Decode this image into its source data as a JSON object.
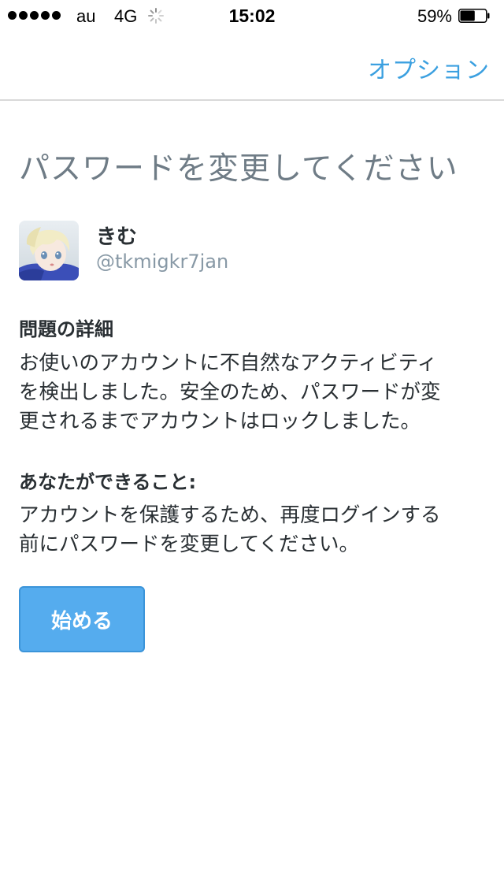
{
  "status_bar": {
    "carrier": "au",
    "network": "4G",
    "time": "15:02",
    "battery_percent": "59%",
    "battery_level": 0.59,
    "signal_bars": 5
  },
  "nav": {
    "options_label": "オプション"
  },
  "main": {
    "title": "パスワードを変更してください",
    "user": {
      "name": "きむ",
      "handle": "@tkmigkr7jan"
    },
    "details": {
      "heading": "問題の詳細",
      "lines": [
        "お使いのアカウントに不自然なアクティビティ",
        "を検出しました。安全のため、パスワードが変",
        "更されるまでアカウントはロックしました。"
      ]
    },
    "actions": {
      "heading": "あなたができること:",
      "lines": [
        "アカウントを保護するため、再度ログインする",
        "前にパスワードを変更してください。"
      ]
    },
    "start_button_label": "始める"
  },
  "colors": {
    "accent": "#3ba0e0",
    "button": "#55acee",
    "title": "#6f7c86",
    "text": "#292f33",
    "muted": "#8899a6"
  },
  "icons": [
    "loading-spinner-icon",
    "battery-icon",
    "signal-strength-icon"
  ]
}
